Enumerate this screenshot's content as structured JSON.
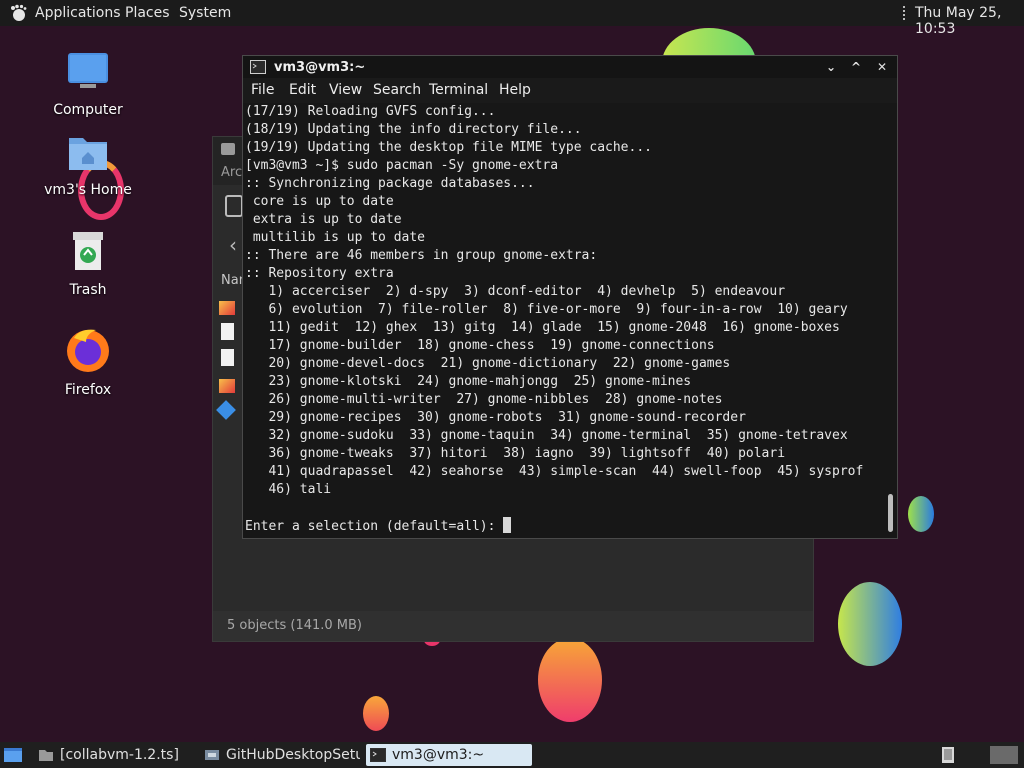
{
  "top_panel": {
    "applications": "Applications",
    "places": "Places",
    "system": "System",
    "clock": "Thu May 25, 10:53"
  },
  "desktop_icons": [
    {
      "label": "Computer",
      "icon": "computer-icon"
    },
    {
      "label": "vm3's Home",
      "icon": "home-folder-icon"
    },
    {
      "label": "Trash",
      "icon": "trash-icon"
    },
    {
      "label": "Firefox",
      "icon": "firefox-icon"
    }
  ],
  "files_window": {
    "partial_title": "Arc",
    "partial_column": "Nan",
    "status": "5 objects (141.0 MB)"
  },
  "terminal": {
    "title": "vm3@vm3:~",
    "menu": [
      "File",
      "Edit",
      "View",
      "Search",
      "Terminal",
      "Help"
    ],
    "lines": [
      "(17/19) Reloading GVFS config...",
      "(18/19) Updating the info directory file...",
      "(19/19) Updating the desktop file MIME type cache...",
      "[vm3@vm3 ~]$ sudo pacman -Sy gnome-extra",
      ":: Synchronizing package databases...",
      " core is up to date",
      " extra is up to date",
      " multilib is up to date",
      ":: There are 46 members in group gnome-extra:",
      ":: Repository extra",
      "   1) accerciser  2) d-spy  3) dconf-editor  4) devhelp  5) endeavour",
      "   6) evolution  7) file-roller  8) five-or-more  9) four-in-a-row  10) geary",
      "   11) gedit  12) ghex  13) gitg  14) glade  15) gnome-2048  16) gnome-boxes",
      "   17) gnome-builder  18) gnome-chess  19) gnome-connections",
      "   20) gnome-devel-docs  21) gnome-dictionary  22) gnome-games",
      "   23) gnome-klotski  24) gnome-mahjongg  25) gnome-mines",
      "   26) gnome-multi-writer  27) gnome-nibbles  28) gnome-notes",
      "   29) gnome-recipes  30) gnome-robots  31) gnome-sound-recorder",
      "   32) gnome-sudoku  33) gnome-taquin  34) gnome-terminal  35) gnome-tetravex",
      "   36) gnome-tweaks  37) hitori  38) iagno  39) lightsoff  40) polari",
      "   41) quadrapassel  42) seahorse  43) simple-scan  44) swell-foop  45) sysprof",
      "   46) tali",
      ""
    ],
    "prompt": "Enter a selection (default=all): "
  },
  "taskbar": {
    "tasks": [
      {
        "label": "[collabvm-1.2.ts]",
        "icon": "folder-icon",
        "active": false
      },
      {
        "label": "GitHubDesktopSetu...",
        "icon": "installer-icon",
        "active": false
      },
      {
        "label": "vm3@vm3:~",
        "icon": "terminal-icon",
        "active": true
      }
    ]
  },
  "colors": {
    "wallpaper": "#2c1225",
    "terminal_bg": "#171717",
    "active_task": "#d9e8f3"
  }
}
